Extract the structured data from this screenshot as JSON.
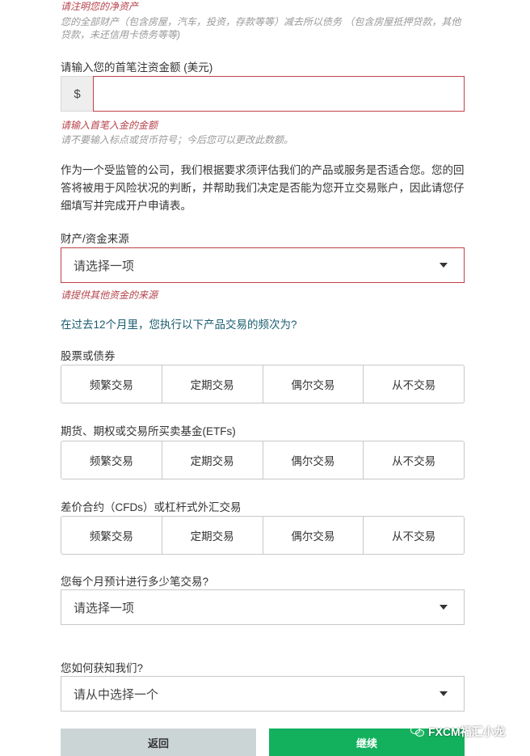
{
  "net_worth": {
    "error": "请注明您的净资产",
    "hint": "您的全部财产（包含房屋，汽车，投资，存款等等）减去所以债务 （包含房屋抵押贷款，其他贷款，未还信用卡债务等等)"
  },
  "deposit": {
    "label": "请输入您的首笔注资金额 (美元)",
    "currency_symbol": "$",
    "value": "",
    "error": "请输入首笔入金的金额",
    "hint": "请不要输入标点或货币符号；今后您可以更改此数额。"
  },
  "regulatory_notice": "作为一个受监管的公司，我们根据要求须评估我们的产品或服务是否适合您。您的回答将被用于风险状况的判断，并帮助我们决定是否能为您开立交易账户，因此请您仔细填写并完成开户申请表。",
  "fund_source": {
    "label": "财产/资金来源",
    "selected": "请选择一项",
    "error": "请提供其他资金的来源"
  },
  "frequency_question": "在过去12个月里，您执行以下产品交易的频次为?",
  "products": [
    {
      "label": "股票或债券",
      "options": [
        "频繁交易",
        "定期交易",
        "偶尔交易",
        "从不交易"
      ]
    },
    {
      "label": "期货、期权或交易所买卖基金(ETFs)",
      "options": [
        "频繁交易",
        "定期交易",
        "偶尔交易",
        "从不交易"
      ]
    },
    {
      "label": "差价合约（CFDs）或杠杆式外汇交易",
      "options": [
        "频繁交易",
        "定期交易",
        "偶尔交易",
        "从不交易"
      ]
    }
  ],
  "monthly_trades": {
    "label": "您每个月预计进行多少笔交易?",
    "selected": "请选择一项"
  },
  "referral": {
    "label": "您如何获知我们?",
    "selected": "请从中选择一个"
  },
  "buttons": {
    "back": "返回",
    "continue": "继续"
  },
  "watermark": "FXCM福汇小龙"
}
